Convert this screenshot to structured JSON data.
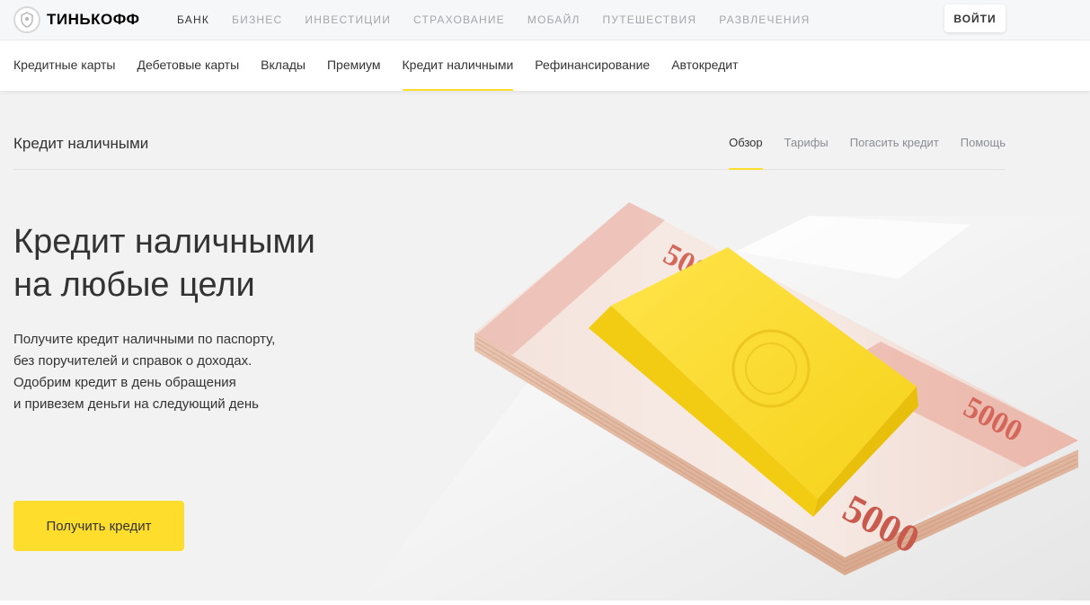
{
  "brand": {
    "name": "ТИНЬКОФФ",
    "logo_icon": "tinkoff-emblem-icon"
  },
  "topnav": {
    "items": [
      "БАНК",
      "БИЗНЕС",
      "ИНВЕСТИЦИИ",
      "СТРАХОВАНИЕ",
      "МОБАЙЛ",
      "ПУТЕШЕСТВИЯ",
      "РАЗВЛЕЧЕНИЯ"
    ],
    "active": "БАНК",
    "login_label": "ВОЙТИ"
  },
  "menu": {
    "items": [
      "Кредитные карты",
      "Дебетовые карты",
      "Вклады",
      "Премиум",
      "Кредит наличными",
      "Рефинансирование",
      "Автокредит"
    ],
    "active": "Кредит наличными"
  },
  "subheader": {
    "title": "Кредит наличными",
    "tabs": [
      "Обзор",
      "Тарифы",
      "Погасить кредит",
      "Помощь"
    ],
    "active": "Обзор"
  },
  "hero": {
    "title_lines": [
      "Кредит наличными",
      "на любые цели"
    ],
    "desc_lines": [
      "Получите кредит наличными по паспорту,",
      "без поручителей и справок о доходах.",
      "Одобрим кредит в день обращения",
      "и привезем деньги на следующий день"
    ],
    "cta_label": "Получить кредит",
    "banknote_denomination": "5000"
  },
  "colors": {
    "accent": "#ffdd2d",
    "background": "#f2f2f2",
    "text": "#333333",
    "muted": "#a3a6ab"
  }
}
